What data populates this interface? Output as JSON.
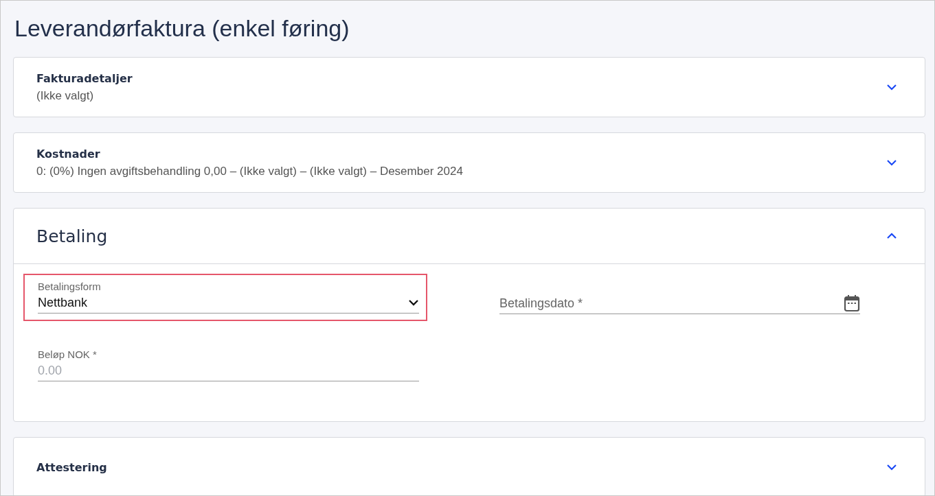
{
  "title": "Leverandørfaktura (enkel føring)",
  "sections": [
    {
      "title": "Fakturadetaljer",
      "summary": "(Ikke valgt)",
      "expanded": false
    },
    {
      "title": "Kostnader",
      "summary": "0: (0%) Ingen avgiftsbehandling 0,00 – (Ikke valgt) – (Ikke valgt) – Desember 2024",
      "expanded": false
    },
    {
      "title": "Betaling",
      "expanded": true,
      "fields": [
        {
          "kind": "select",
          "label": "Betalingsform",
          "value": "Nettbank",
          "highlighted": true
        },
        {
          "kind": "date",
          "placeholder": "Betalingsdato *",
          "highlighted": false
        },
        {
          "kind": "amount",
          "label": "Beløp NOK *",
          "placeholder": "0.00",
          "highlighted": false
        }
      ]
    },
    {
      "title": "Attestering",
      "expanded": false
    }
  ]
}
